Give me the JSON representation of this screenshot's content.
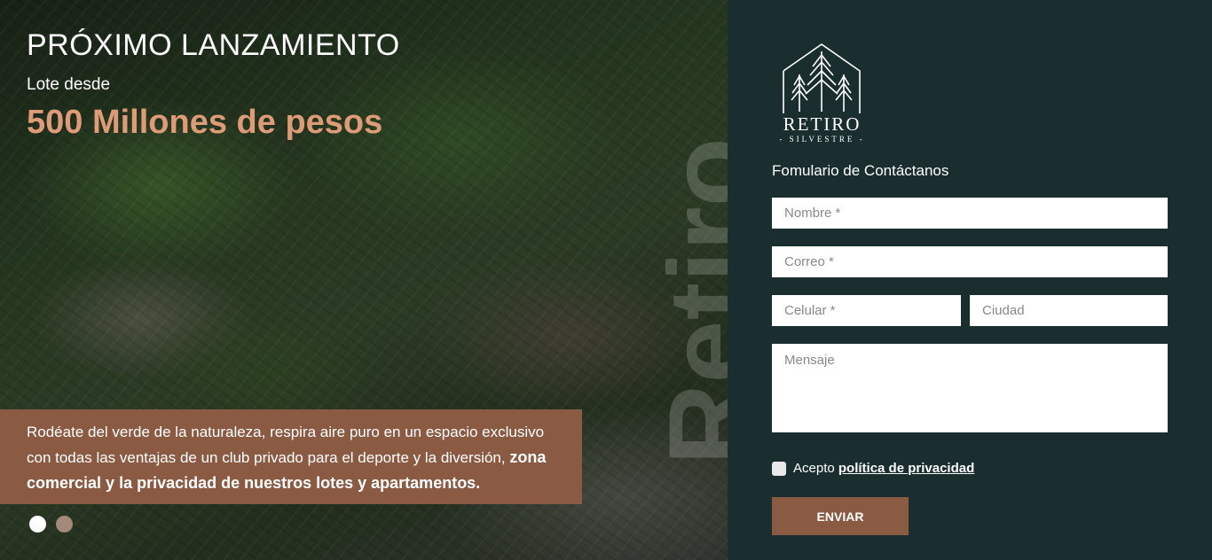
{
  "hero": {
    "title": "PRÓXIMO LANZAMIENTO",
    "subtitle": "Lote desde",
    "price": "500 Millones de pesos",
    "watermark": "Retiro",
    "description_regular": "Rodéate del verde de la naturaleza, respira aire puro en un espacio exclusivo con todas las ventajas de un club privado para el deporte y la diversión, ",
    "description_bold": "zona comercial y la privacidad de nuestros lotes y apartamentos.",
    "slides": 2,
    "active_slide": 1
  },
  "brand": {
    "name": "RETIRO",
    "tagline": "- SILVESTRE -"
  },
  "form": {
    "title": "Fomulario de Contáctanos",
    "name_placeholder": "Nombre *",
    "email_placeholder": "Correo *",
    "phone_placeholder": "Celular *",
    "city_placeholder": "Ciudad",
    "message_placeholder": "Mensaje",
    "consent_prefix": "Acepto ",
    "consent_link": "política de privacidad",
    "submit_label": "ENVIAR"
  },
  "colors": {
    "panel_bg": "#1a2e2f",
    "accent": "#8b5a43",
    "price_color": "#dd9b78"
  }
}
